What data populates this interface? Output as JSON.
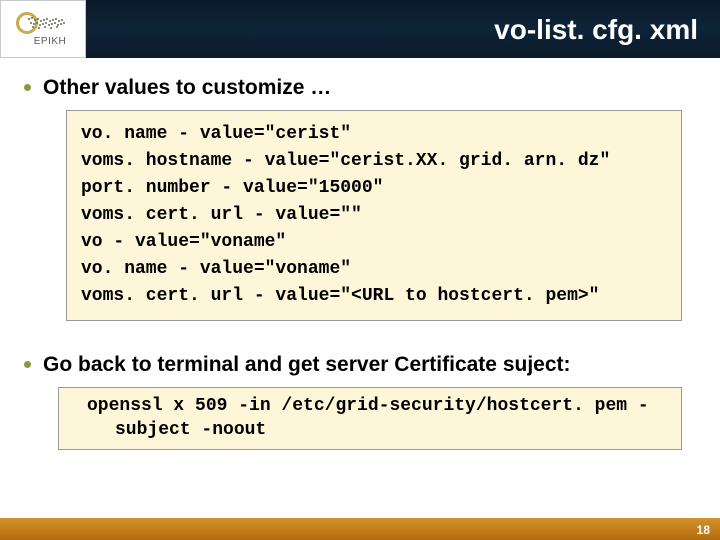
{
  "header": {
    "logo_text": "EPIKH",
    "title": "vo-list. cfg. xml"
  },
  "bullets": {
    "b1": "Other values to customize …",
    "b2": "Go back to terminal and get server Certificate suject:"
  },
  "code1": {
    "l1": "vo. name - value=\"cerist\"",
    "l2": "voms. hostname - value=\"cerist.XX. grid. arn. dz\"",
    "l3": "port. number - value=\"15000\"",
    "l4": "voms. cert. url - value=\"\"",
    "l5": "vo - value=\"voname\"",
    "l6": "vo. name - value=\"voname\"",
    "l7": "voms. cert. url - value=\"<URL to hostcert. pem>\""
  },
  "code2": {
    "cmd": "openssl x 509 -in /etc/grid-security/hostcert. pem -subject -noout"
  },
  "footer": {
    "page": "18"
  }
}
